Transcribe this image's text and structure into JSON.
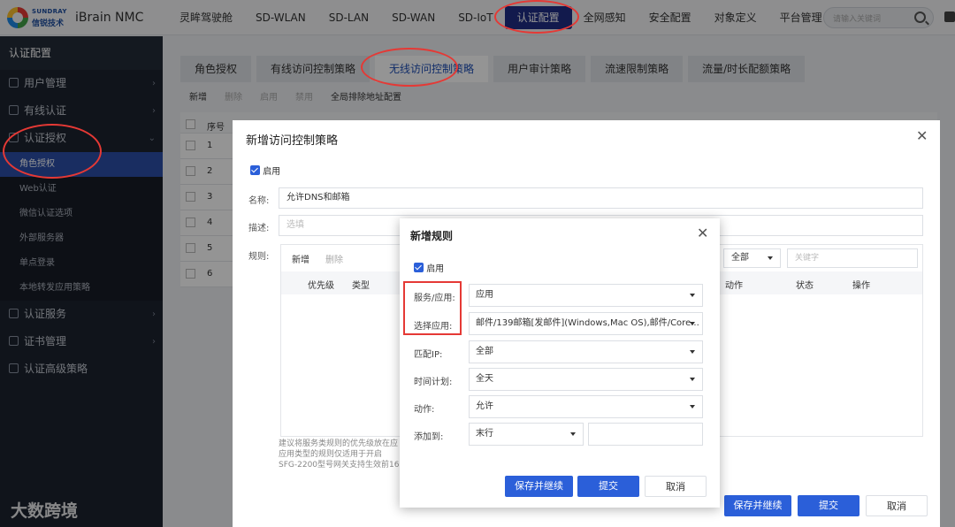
{
  "header": {
    "brand_en": "SUNDRAY",
    "brand_cn": "信锐技术",
    "product": "iBrain NMC",
    "nav": [
      "灵眸驾驶舱",
      "SD-WLAN",
      "SD-LAN",
      "SD-WAN",
      "SD-IoT",
      "认证配置",
      "全网感知",
      "安全配置",
      "对象定义",
      "平台管理"
    ],
    "active_nav": "认证配置",
    "search_placeholder": "请输入关键词"
  },
  "sidebar": {
    "title": "认证配置",
    "groups": [
      "用户管理",
      "有线认证",
      "认证授权"
    ],
    "subitems": [
      "角色授权",
      "Web认证",
      "微信认证选项",
      "外部服务器",
      "单点登录",
      "本地转发应用策略"
    ],
    "groups_after": [
      "认证服务",
      "证书管理",
      "认证高级策略"
    ],
    "watermark": "大数跨境"
  },
  "main": {
    "tabs": [
      "角色授权",
      "有线访问控制策略",
      "无线访问控制策略",
      "用户审计策略",
      "流速限制策略",
      "流量/时长配额策略"
    ],
    "active_tab": "无线访问控制策略",
    "toolbar": {
      "add": "新增",
      "delete": "删除",
      "enable": "启用",
      "disable": "禁用",
      "global": "全局排除地址配置"
    },
    "table_head": "序号",
    "rows": [
      "1",
      "2",
      "3",
      "4",
      "5",
      "6"
    ]
  },
  "dialog_policy": {
    "title": "新增访问控制策略",
    "enable_label": "启用",
    "name_label": "名称:",
    "name_value": "允许DNS和邮箱",
    "desc_label": "描述:",
    "desc_placeholder": "选填",
    "rules_label": "规则:",
    "rules_add": "新增",
    "rules_delete": "删除",
    "filter_all": "全部",
    "keyword_placeholder": "关键字",
    "cols": [
      "优先级",
      "类型",
      "动作",
      "状态",
      "操作"
    ],
    "note_lines": [
      "建议将服务类规则的优先级放在应",
      "应用类型的规则仅适用于开启",
      "SFG-2200型号网关支持生效前16"
    ],
    "btn_save_continue": "保存并继续",
    "btn_submit": "提交",
    "btn_cancel": "取消"
  },
  "dialog_rule": {
    "title": "新增规则",
    "enable_label": "启用",
    "fields": [
      {
        "label": "服务/应用:",
        "value": "应用"
      },
      {
        "label": "选择应用:",
        "value": "邮件/139邮箱[发邮件](Windows,Mac OS),邮件/Core..."
      },
      {
        "label": "匹配IP:",
        "value": "全部"
      },
      {
        "label": "时间计划:",
        "value": "全天"
      },
      {
        "label": "动作:",
        "value": "允许"
      }
    ],
    "add_to_label": "添加到:",
    "add_to_value": "末行",
    "btn_save_continue": "保存并继续",
    "btn_submit": "提交",
    "btn_cancel": "取消"
  }
}
